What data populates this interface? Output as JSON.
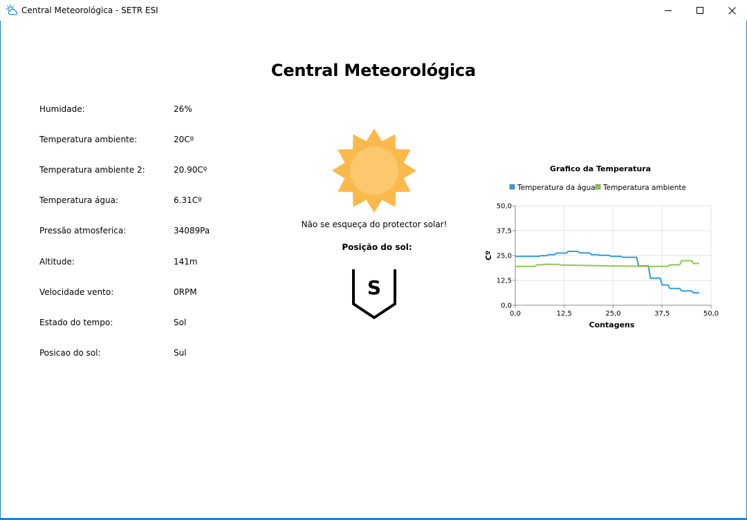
{
  "window": {
    "title": "Central Meteorológica - SETR ESI",
    "icon": "weather-cloud-sun-icon"
  },
  "heading": "Central Meteorológica",
  "readings": [
    {
      "label": "Humidade:",
      "value": "26%"
    },
    {
      "label": "Temperatura ambiente:",
      "value": "20Cº"
    },
    {
      "label": "Temperatura ambiente 2:",
      "value": "20.90Cº"
    },
    {
      "label": "Temperatura água:",
      "value": "6.31Cº"
    },
    {
      "label": "Pressão atmosferica:",
      "value": "34089Pa"
    },
    {
      "label": "Altitude:",
      "value": "141m"
    },
    {
      "label": "Velocidade vento:",
      "value": "0RPM"
    },
    {
      "label": "Estado do tempo:",
      "value": "Sol"
    },
    {
      "label": "Posicao do sol:",
      "value": "Sul"
    }
  ],
  "weather": {
    "icon": "sun-icon",
    "advice": "Não se esqueça do protector solar!",
    "position_label": "Posição do sol:",
    "compass_letter": "S",
    "sun_color": "#fbb94c",
    "sun_inner_color": "#fcc86e"
  },
  "chart_data": {
    "type": "line",
    "title": "Grafico da Temperatura",
    "xlabel": "Contagens",
    "ylabel": "Cº",
    "xlim": [
      0,
      50
    ],
    "ylim": [
      0,
      50
    ],
    "xticks": [
      "0,0",
      "12,5",
      "25,0",
      "37,5",
      "50,0"
    ],
    "yticks": [
      "0,0",
      "12,5",
      "25,0",
      "37,5",
      "50,0"
    ],
    "grid": true,
    "legend": "top",
    "series": [
      {
        "name": "Temperatura da água",
        "color": "#2b9fd9",
        "points": [
          [
            0,
            24.6
          ],
          [
            6,
            24.6
          ],
          [
            6.5,
            24.9
          ],
          [
            8,
            24.9
          ],
          [
            8.5,
            25.4
          ],
          [
            10,
            25.4
          ],
          [
            10.5,
            26.2
          ],
          [
            13,
            26.2
          ],
          [
            13.5,
            27.1
          ],
          [
            16,
            27.1
          ],
          [
            16.5,
            26.3
          ],
          [
            19,
            26.3
          ],
          [
            19.5,
            25.4
          ],
          [
            21,
            25.4
          ],
          [
            21.5,
            25.1
          ],
          [
            24,
            25.1
          ],
          [
            24.5,
            24.6
          ],
          [
            27,
            24.6
          ],
          [
            27.5,
            24.1
          ],
          [
            31,
            24.1
          ],
          [
            31.5,
            19.8
          ],
          [
            34,
            19.8
          ],
          [
            34.5,
            13.6
          ],
          [
            37,
            13.6
          ],
          [
            37.5,
            10.2
          ],
          [
            39,
            10.2
          ],
          [
            39.5,
            8.4
          ],
          [
            42,
            8.4
          ],
          [
            42.5,
            7.2
          ],
          [
            45,
            7.2
          ],
          [
            45.5,
            6.3
          ],
          [
            47,
            6.3
          ]
        ]
      },
      {
        "name": "Temperatura ambiente",
        "color": "#8fc550",
        "points": [
          [
            0,
            19.5
          ],
          [
            5,
            19.5
          ],
          [
            5.5,
            20.3
          ],
          [
            7,
            20.3
          ],
          [
            7.5,
            20.6
          ],
          [
            11,
            20.6
          ],
          [
            11.5,
            20.2
          ],
          [
            21,
            19.9
          ],
          [
            34,
            19.5
          ],
          [
            39,
            19.5
          ],
          [
            39.5,
            20.3
          ],
          [
            42,
            20.3
          ],
          [
            42.5,
            22.4
          ],
          [
            45,
            22.4
          ],
          [
            45.5,
            21.0
          ],
          [
            47,
            21.0
          ]
        ]
      }
    ]
  }
}
